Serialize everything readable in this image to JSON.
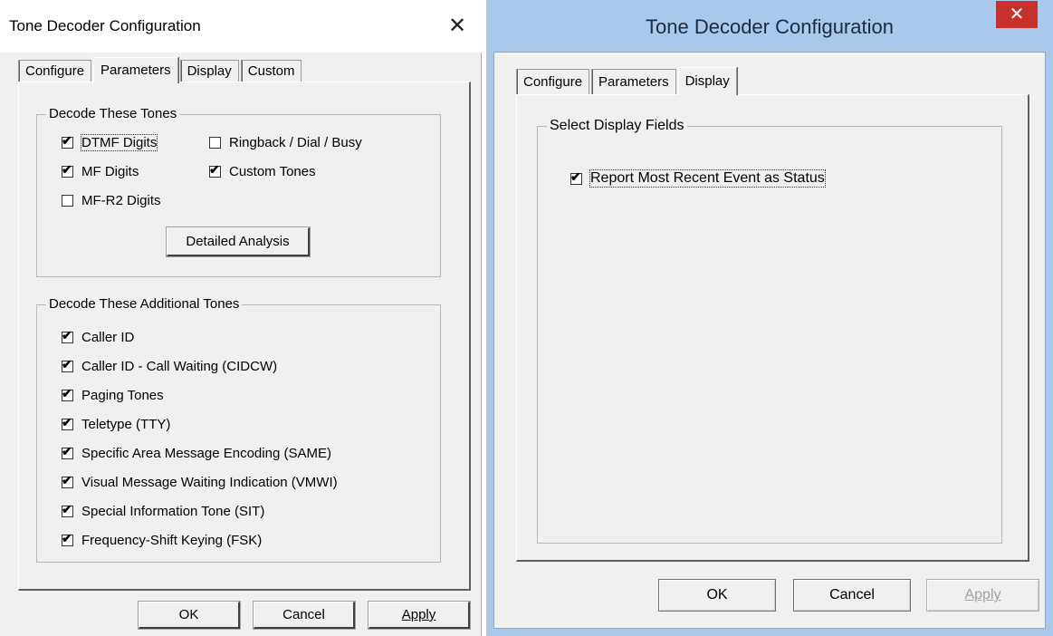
{
  "left": {
    "title": "Tone Decoder Configuration",
    "close_glyph": "✕",
    "tabs": [
      "Configure",
      "Parameters",
      "Display",
      "Custom"
    ],
    "active_tab": "Parameters",
    "group1": {
      "label": "Decode These Tones",
      "items": [
        {
          "label": "DTMF Digits",
          "checked": true
        },
        {
          "label": "Ringback / Dial / Busy",
          "checked": false
        },
        {
          "label": "MF Digits",
          "checked": true
        },
        {
          "label": "Custom Tones",
          "checked": true
        },
        {
          "label": "MF-R2 Digits",
          "checked": false
        }
      ],
      "button": "Detailed Analysis"
    },
    "group2": {
      "label": "Decode These Additional Tones",
      "items": [
        {
          "label": "Caller ID",
          "checked": true
        },
        {
          "label": "Caller ID - Call Waiting (CIDCW)",
          "checked": true
        },
        {
          "label": "Paging Tones",
          "checked": true
        },
        {
          "label": "Teletype (TTY)",
          "checked": true
        },
        {
          "label": "Specific Area Message Encoding (SAME)",
          "checked": true
        },
        {
          "label": "Visual Message Waiting Indication (VMWI)",
          "checked": true
        },
        {
          "label": "Special Information Tone (SIT)",
          "checked": true
        },
        {
          "label": "Frequency-Shift Keying (FSK)",
          "checked": true
        }
      ]
    },
    "buttons": {
      "ok": "OK",
      "cancel": "Cancel",
      "apply": "Apply"
    }
  },
  "right": {
    "title": "Tone Decoder Configuration",
    "close_glyph": "✕",
    "tabs": [
      "Configure",
      "Parameters",
      "Display"
    ],
    "active_tab": "Display",
    "group": {
      "label": "Select Display Fields",
      "items": [
        {
          "label": "Report Most Recent Event as Status",
          "checked": true
        }
      ]
    },
    "buttons": {
      "ok": "OK",
      "cancel": "Cancel",
      "apply": "Apply",
      "apply_disabled": true
    }
  },
  "check_glyph": "✔"
}
